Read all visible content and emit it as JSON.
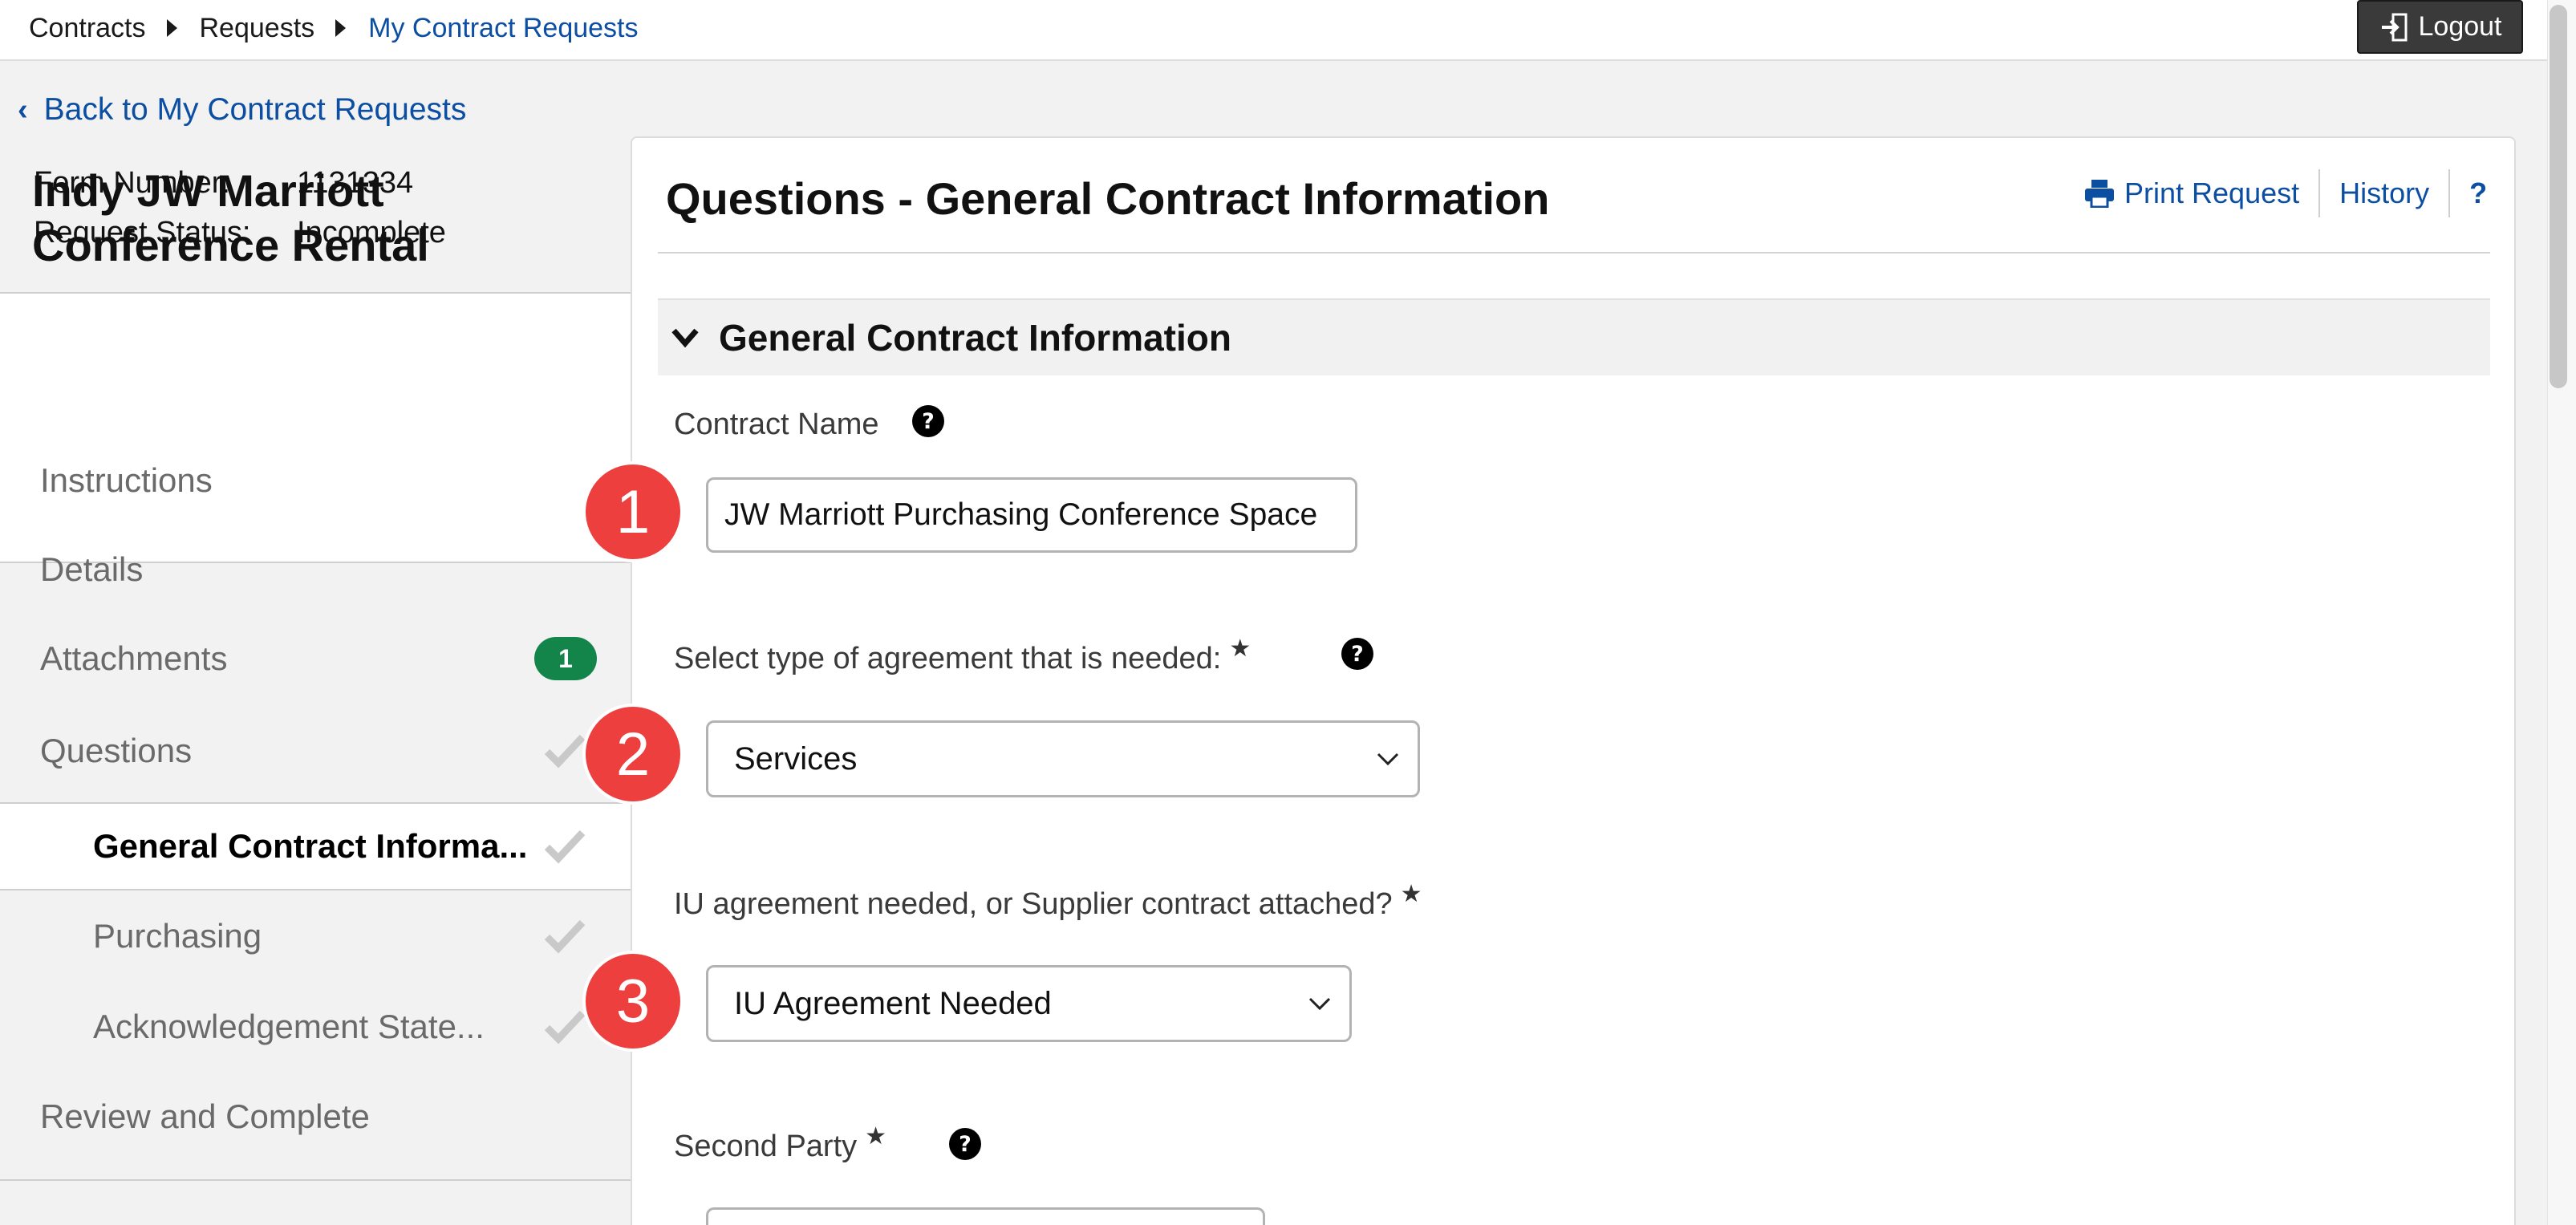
{
  "breadcrumb": {
    "items": [
      "Contracts",
      "Requests",
      "My Contract Requests"
    ]
  },
  "header": {
    "logout_label": "Logout"
  },
  "back_link": "Back to My Contract Requests",
  "request": {
    "title": "Indy JW Marriott Conference Rental",
    "form_number_label": "Form Number:",
    "form_number": "1131334",
    "status_label": "Request Status:",
    "status": "Incomplete"
  },
  "nav": {
    "items": [
      {
        "label": "Instructions"
      },
      {
        "label": "Details"
      },
      {
        "label": "Attachments",
        "badge": "1"
      },
      {
        "label": "Questions"
      },
      {
        "label": "General Contract Informa..."
      },
      {
        "label": "Purchasing"
      },
      {
        "label": "Acknowledgement State..."
      },
      {
        "label": "Review and Complete"
      }
    ]
  },
  "main": {
    "page_title": "Questions - General Contract Information",
    "actions": {
      "print": "Print Request",
      "history": "History",
      "help": "?"
    },
    "section_title": "General Contract Information",
    "fields": {
      "contract_name": {
        "label": "Contract Name",
        "value": "JW Marriott Purchasing Conference Space"
      },
      "agreement_type": {
        "label": "Select type of agreement that is needed:",
        "required": "★",
        "value": "Services"
      },
      "iu_agreement": {
        "label": "IU agreement needed, or Supplier contract attached?",
        "required": "★",
        "value": "IU Agreement Needed"
      },
      "second_party": {
        "label": "Second Party",
        "required": "★"
      }
    }
  },
  "markers": [
    "1",
    "2",
    "3"
  ],
  "colors": {
    "link": "#0b4ea2",
    "badge": "#13854a",
    "marker": "#ee3f3f",
    "logout_bg": "#3a3a3a"
  }
}
